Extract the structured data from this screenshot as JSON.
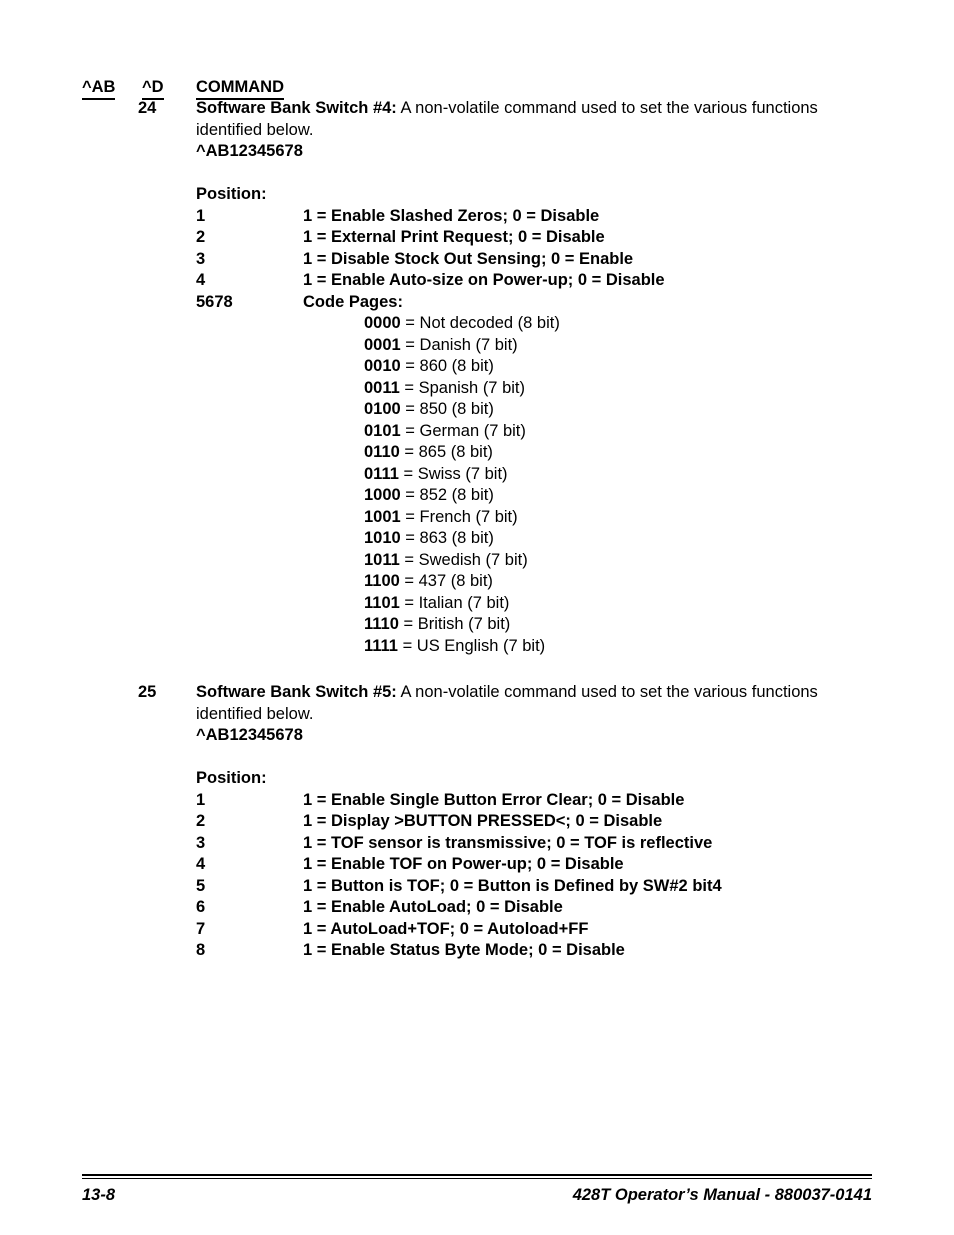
{
  "table_header": {
    "col_ab": "^AB",
    "col_d": "^D",
    "col_command": "COMMAND"
  },
  "commands": [
    {
      "number": "24",
      "title": "Software Bank Switch #4:",
      "description": " A non-volatile command used to set the various functions identified below.",
      "syntax": "^AB12345678",
      "position_label": "Position:",
      "positions": [
        {
          "key": "1",
          "value": "1 = Enable Slashed Zeros; 0 = Disable"
        },
        {
          "key": "2",
          "value": "1 = External Print Request; 0 = Disable"
        },
        {
          "key": "3",
          "value": "1 = Disable Stock Out Sensing; 0 = Enable"
        },
        {
          "key": "4",
          "value": "1 = Enable Auto-size on Power-up; 0 = Disable"
        },
        {
          "key": "5678",
          "value": "Code Pages:"
        }
      ],
      "code_pages": [
        {
          "code": "0000",
          "desc": " = Not decoded (8 bit)"
        },
        {
          "code": "0001",
          "desc": " = Danish (7 bit)"
        },
        {
          "code": "0010",
          "desc": " = 860 (8 bit)"
        },
        {
          "code": "0011",
          "desc": " = Spanish (7 bit)"
        },
        {
          "code": "0100",
          "desc": " = 850 (8 bit)"
        },
        {
          "code": "0101",
          "desc": " = German (7 bit)"
        },
        {
          "code": "0110",
          "desc": " = 865 (8 bit)"
        },
        {
          "code": "0111",
          "desc": " = Swiss (7 bit)"
        },
        {
          "code": "1000",
          "desc": " = 852 (8 bit)"
        },
        {
          "code": "1001",
          "desc": " = French (7 bit)"
        },
        {
          "code": "1010",
          "desc": " = 863 (8 bit)"
        },
        {
          "code": "1011",
          "desc": " = Swedish (7 bit)"
        },
        {
          "code": "1100",
          "desc": " = 437 (8 bit)"
        },
        {
          "code": "1101",
          "desc": " = Italian (7 bit)"
        },
        {
          "code": "1110",
          "desc": " = British (7 bit)"
        },
        {
          "code": "1111",
          "desc": " = US English (7 bit)"
        }
      ]
    },
    {
      "number": "25",
      "title": "Software Bank Switch #5:",
      "description": "  A non-volatile command used to set the various functions identified below.",
      "syntax": "^AB12345678",
      "position_label": "Position:",
      "positions": [
        {
          "key": "1",
          "value": "1 = Enable Single Button Error Clear; 0 = Disable"
        },
        {
          "key": "2",
          "value": "1 = Display >BUTTON PRESSED<; 0 = Disable"
        },
        {
          "key": "3",
          "value": "1 = TOF sensor is transmissive; 0 = TOF is reflective"
        },
        {
          "key": "4",
          "value": "1 = Enable TOF on Power-up; 0 = Disable"
        },
        {
          "key": "5",
          "value": "1 = Button is TOF; 0 = Button is Defined by SW#2 bit4"
        },
        {
          "key": "6",
          "value": "1 = Enable AutoLoad; 0 = Disable"
        },
        {
          "key": "7",
          "value": "1 = AutoLoad+TOF; 0 = Autoload+FF"
        },
        {
          "key": "8",
          "value": "1 = Enable Status Byte Mode; 0 = Disable"
        }
      ],
      "code_pages": []
    }
  ],
  "footer": {
    "page_number": "13-8",
    "manual_title": "428T Operator’s Manual - 880037-0141"
  }
}
